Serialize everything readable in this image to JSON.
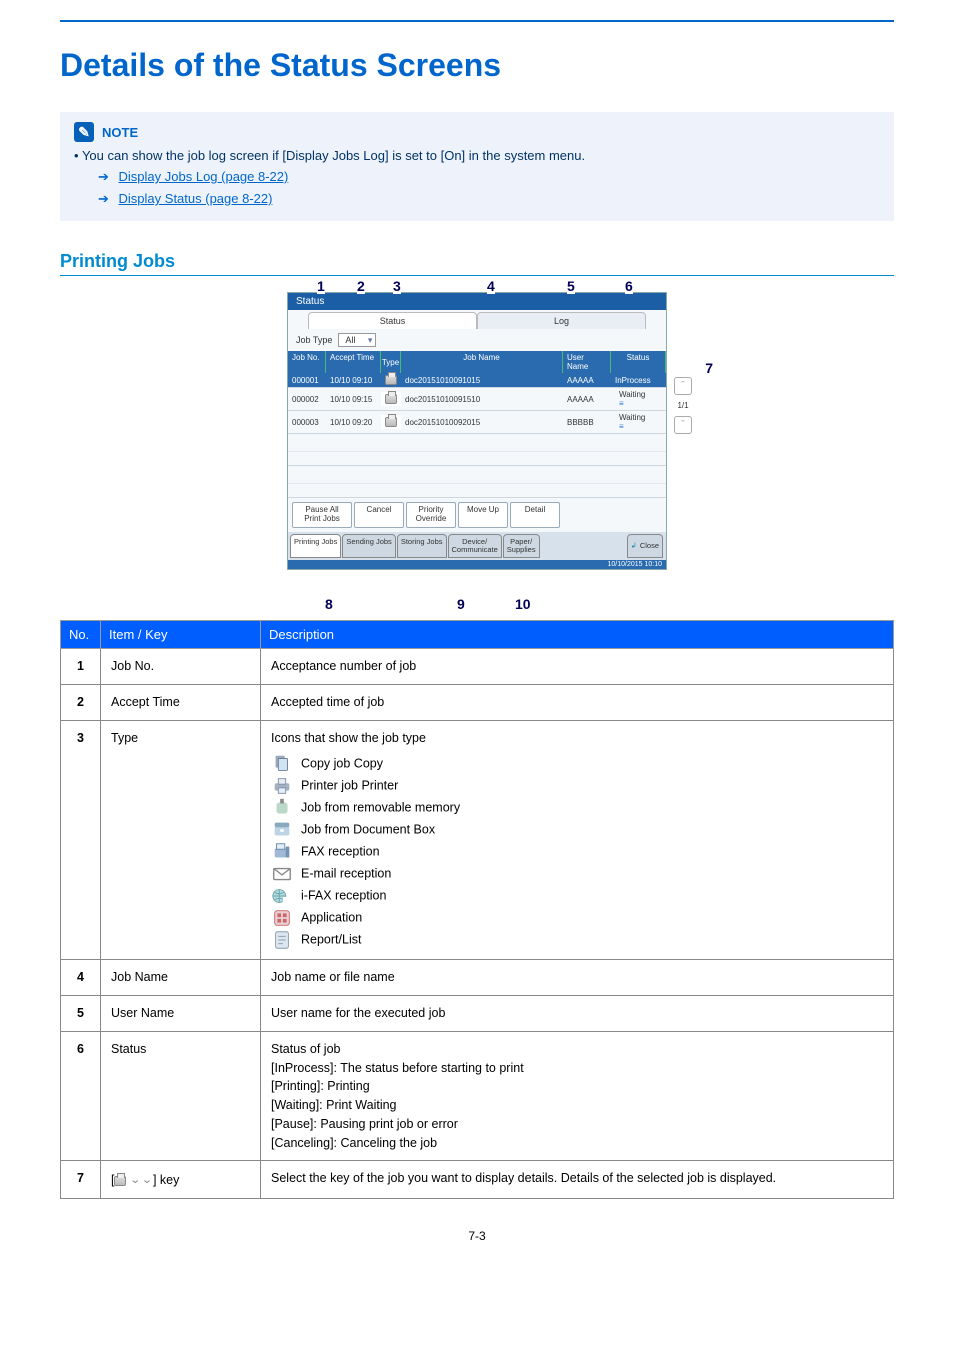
{
  "heading": "Details of the Status Screens",
  "note": {
    "label": "NOTE",
    "lines": [
      {
        "pre": "You can show the job log screen if [Display Jobs Log] is set to [On] in the system menu."
      },
      {
        "link1_text": "Display Jobs Log (page 8-22)",
        "link1_ref": "page 8-22"
      },
      {
        "link2_text": "Display Status (page 8-22)",
        "link2_ref": "page 8-22"
      }
    ]
  },
  "section_title": "Printing Jobs",
  "screenshot": {
    "title_bar": "Status",
    "top_tabs": {
      "status": "Status",
      "log": "Log"
    },
    "job_type_label": "Job Type",
    "job_type_value": "All",
    "columns": {
      "jobno": "Job No.",
      "accept": "Accept Time",
      "type": "Type",
      "jobname": "Job Name",
      "user": "User Name",
      "status": "Status"
    },
    "rows": [
      {
        "no": "000001",
        "time": "10/10 09:10",
        "name": "doc20151010091015",
        "user": "AAAAA",
        "status": "InProcess"
      },
      {
        "no": "000002",
        "time": "10/10 09:15",
        "name": "doc20151010091510",
        "user": "AAAAA",
        "status": "Waiting"
      },
      {
        "no": "000003",
        "time": "10/10 09:20",
        "name": "doc20151010092015",
        "user": "BBBBB",
        "status": "Waiting"
      }
    ],
    "page_indicator": "1/1",
    "buttons": {
      "pause": "Pause All\nPrint Jobs",
      "cancel": "Cancel",
      "priority": "Priority\nOverride",
      "moveup": "Move Up",
      "detail": "Detail"
    },
    "bottom_tabs": {
      "printing": "Printing Jobs",
      "sending": "Sending Jobs",
      "storing": "Storing Jobs",
      "device": "Device/\nCommunicate",
      "paper": "Paper/\nSupplies"
    },
    "close": "Close",
    "timestamp": "10/10/2015    10:10",
    "callouts": [
      "1",
      "2",
      "3",
      "4",
      "5",
      "6",
      "7",
      "8",
      "9",
      "10"
    ]
  },
  "table": {
    "head": {
      "no": "No.",
      "item": "Item / Key",
      "desc": "Description"
    },
    "rows": [
      {
        "n": "1",
        "item": "Job No.",
        "desc": "Acceptance number of job"
      },
      {
        "n": "2",
        "item": "Accept Time",
        "desc": "Accepted time of job"
      },
      {
        "n": "3",
        "item": "Type",
        "desc_intro": "Icons that show the job type",
        "icons": [
          {
            "name": "copy-icon",
            "label": "Copy job Copy"
          },
          {
            "name": "printer-icon",
            "label": "Printer job Printer"
          },
          {
            "name": "usb-icon",
            "label": "Job from removable memory"
          },
          {
            "name": "box-icon",
            "label": "Job from Document Box"
          },
          {
            "name": "fax-icon",
            "label": "FAX reception"
          },
          {
            "name": "mail-icon",
            "label": "E-mail reception"
          },
          {
            "name": "ifax-icon",
            "label": "i-FAX reception"
          },
          {
            "name": "app-icon",
            "label": "Application"
          },
          {
            "name": "report-icon",
            "label": "Report/List"
          }
        ]
      },
      {
        "n": "4",
        "item": "Job Name",
        "desc": "Job name or file name"
      },
      {
        "n": "5",
        "item": "User Name",
        "desc": "User name for the executed job"
      },
      {
        "n": "6",
        "item": "Status",
        "desc_lines": [
          "Status of job",
          "[InProcess]: The status before starting to print",
          "[Printing]: Printing",
          "[Waiting]: Print Waiting",
          "[Pause]: Pausing print job or error",
          "[Canceling]: Canceling the job"
        ]
      },
      {
        "n": "7",
        "item_icon": "printer-mini",
        "item_chev": "⌄",
        "item_suffix": "key",
        "desc": "Select the key of the job you want to display details. Details of the selected job is displayed."
      }
    ]
  },
  "page_number": "7-3"
}
